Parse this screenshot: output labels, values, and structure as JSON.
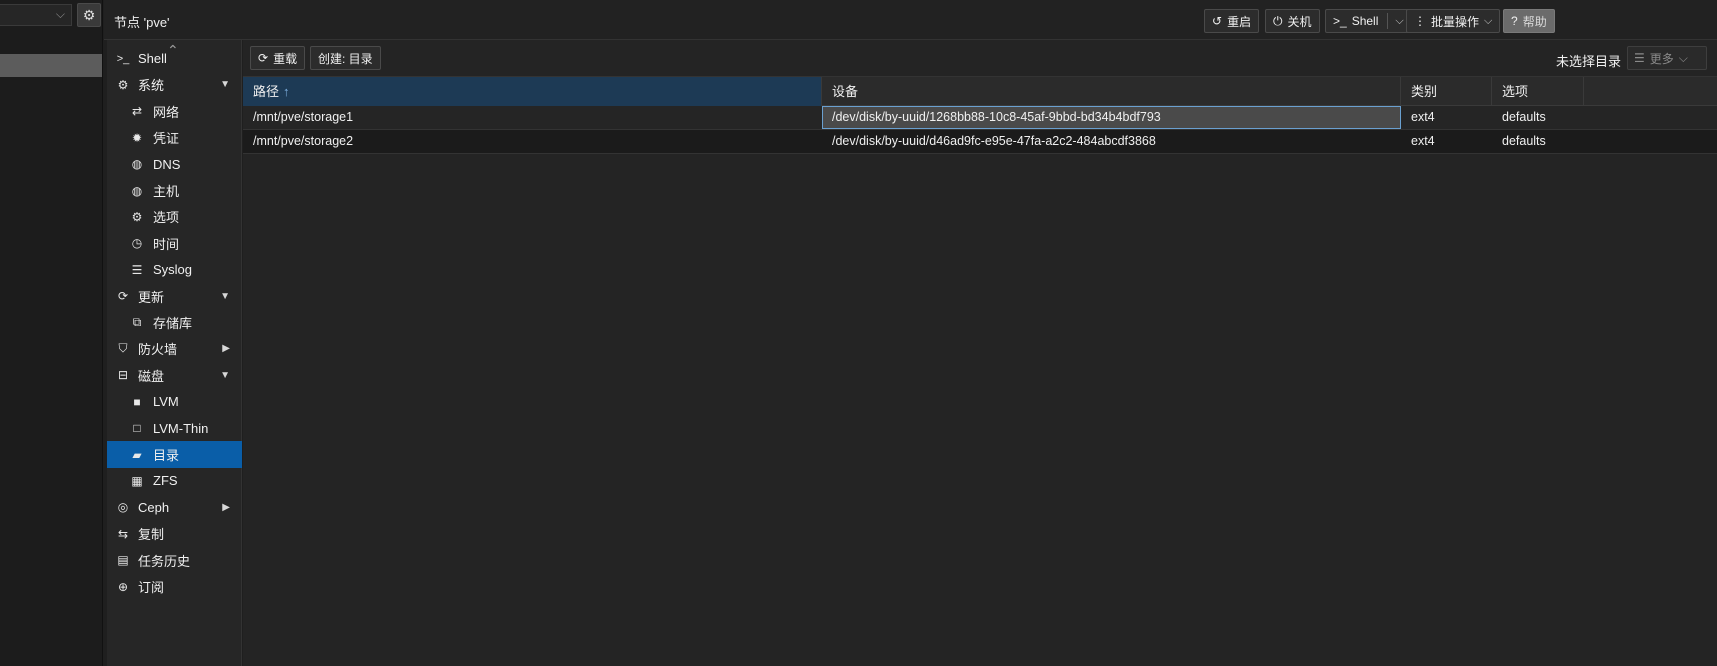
{
  "header": {
    "title": "节点 'pve'",
    "buttons": {
      "reboot": "重启",
      "shutdown": "关机",
      "shell": "Shell",
      "bulk": "批量操作",
      "help": "帮助"
    }
  },
  "nav": {
    "items": [
      {
        "label": "Shell",
        "icon": "terminal-icon",
        "level": 0
      },
      {
        "label": "系统",
        "icon": "cogs-icon",
        "level": 0,
        "expander": "down"
      },
      {
        "label": "网络",
        "icon": "exchange-icon",
        "level": 1
      },
      {
        "label": "凭证",
        "icon": "certificate-icon",
        "level": 1
      },
      {
        "label": "DNS",
        "icon": "globe-icon",
        "level": 1
      },
      {
        "label": "主机",
        "icon": "globe-icon",
        "level": 1
      },
      {
        "label": "选项",
        "icon": "gear-icon",
        "level": 1
      },
      {
        "label": "时间",
        "icon": "clock-icon",
        "level": 1
      },
      {
        "label": "Syslog",
        "icon": "list-icon",
        "level": 1
      },
      {
        "label": "更新",
        "icon": "refresh-icon",
        "level": 0,
        "expander": "down"
      },
      {
        "label": "存储库",
        "icon": "files-icon",
        "level": 1
      },
      {
        "label": "防火墙",
        "icon": "shield-icon",
        "level": 0,
        "expander": "right"
      },
      {
        "label": "磁盘",
        "icon": "hdd-icon",
        "level": 0,
        "expander": "down"
      },
      {
        "label": "LVM",
        "icon": "square-icon",
        "level": 1
      },
      {
        "label": "LVM-Thin",
        "icon": "square-outline-icon",
        "level": 1
      },
      {
        "label": "目录",
        "icon": "folder-icon",
        "level": 1,
        "active": true
      },
      {
        "label": "ZFS",
        "icon": "grid-icon",
        "level": 1
      },
      {
        "label": "Ceph",
        "icon": "ceph-icon",
        "level": 0,
        "expander": "right"
      },
      {
        "label": "复制",
        "icon": "retweet-icon",
        "level": 0
      },
      {
        "label": "任务历史",
        "icon": "list-alt-icon",
        "level": 0
      },
      {
        "label": "订阅",
        "icon": "support-icon",
        "level": 0
      }
    ]
  },
  "toolbar": {
    "reload": "重载",
    "create": "创建: 目录",
    "no_selection": "未选择目录",
    "more": "更多"
  },
  "grid": {
    "columns": [
      "路径",
      "设备",
      "类别",
      "选项"
    ],
    "sort_indicator": "↑",
    "rows": [
      {
        "path": "/mnt/pve/storage1",
        "device": "/dev/disk/by-uuid/1268bb88-10c8-45af-9bbd-bd34b4bdf793",
        "type": "ext4",
        "options": "defaults"
      },
      {
        "path": "/mnt/pve/storage2",
        "device": "/dev/disk/by-uuid/d46ad9fc-e95e-47fa-a2c2-484abcdf3868",
        "type": "ext4",
        "options": "defaults"
      }
    ]
  },
  "colors": {
    "accent": "#0a5ea8",
    "sorted_header": "#1d3a55",
    "background": "#1f1f1f"
  }
}
